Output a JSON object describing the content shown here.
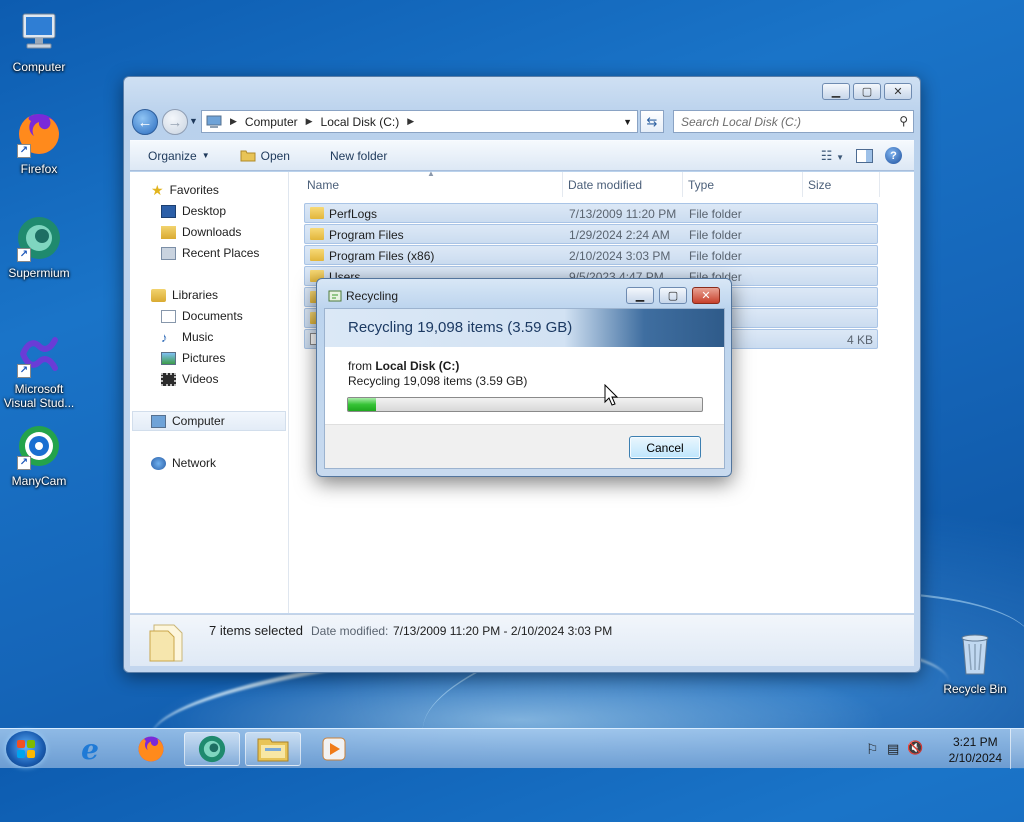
{
  "desktop": {
    "icons": [
      {
        "label": "Computer"
      },
      {
        "label": "Firefox"
      },
      {
        "label": "Supermium"
      },
      {
        "label": "Microsoft Visual Stud..."
      },
      {
        "label": "ManyCam"
      },
      {
        "label": "Recycle Bin"
      }
    ]
  },
  "explorer": {
    "address": {
      "crumbs": [
        "Computer",
        "Local Disk (C:)"
      ]
    },
    "search_placeholder": "Search Local Disk (C:)",
    "toolbar": {
      "organize": "Organize",
      "open": "Open",
      "new_folder": "New folder"
    },
    "nav": {
      "favorites": "Favorites",
      "favorites_items": [
        "Desktop",
        "Downloads",
        "Recent Places"
      ],
      "libraries": "Libraries",
      "libraries_items": [
        "Documents",
        "Music",
        "Pictures",
        "Videos"
      ],
      "computer": "Computer",
      "network": "Network"
    },
    "columns": {
      "name": "Name",
      "date": "Date modified",
      "type": "Type",
      "size": "Size"
    },
    "files": [
      {
        "name": "PerfLogs",
        "date": "7/13/2009 11:20 PM",
        "type": "File folder",
        "size": ""
      },
      {
        "name": "Program Files",
        "date": "1/29/2024 2:24 AM",
        "type": "File folder",
        "size": ""
      },
      {
        "name": "Program Files (x86)",
        "date": "2/10/2024 3:03 PM",
        "type": "File folder",
        "size": ""
      },
      {
        "name": "Users",
        "date": "9/5/2023 4:47 PM",
        "type": "File folder",
        "size": ""
      },
      {
        "name": "",
        "date": "",
        "type": "lder",
        "size": ""
      },
      {
        "name": "",
        "date": "",
        "type": "lder",
        "size": ""
      },
      {
        "name": "",
        "date": "",
        "type": "",
        "size": "4 KB"
      }
    ],
    "details": {
      "count": "7 items selected",
      "date_label": "Date modified:",
      "date_value": "7/13/2009 11:20 PM - 2/10/2024 3:03 PM"
    }
  },
  "dialog": {
    "title": "Recycling",
    "heading": "Recycling 19,098 items (3.59 GB)",
    "from_prefix": "from",
    "from_location": "Local Disk (C:)",
    "status": "Recycling 19,098 items (3.59 GB)",
    "progress": 0.08,
    "cancel": "Cancel"
  },
  "taskbar": {
    "time": "3:21 PM",
    "date": "2/10/2024"
  }
}
